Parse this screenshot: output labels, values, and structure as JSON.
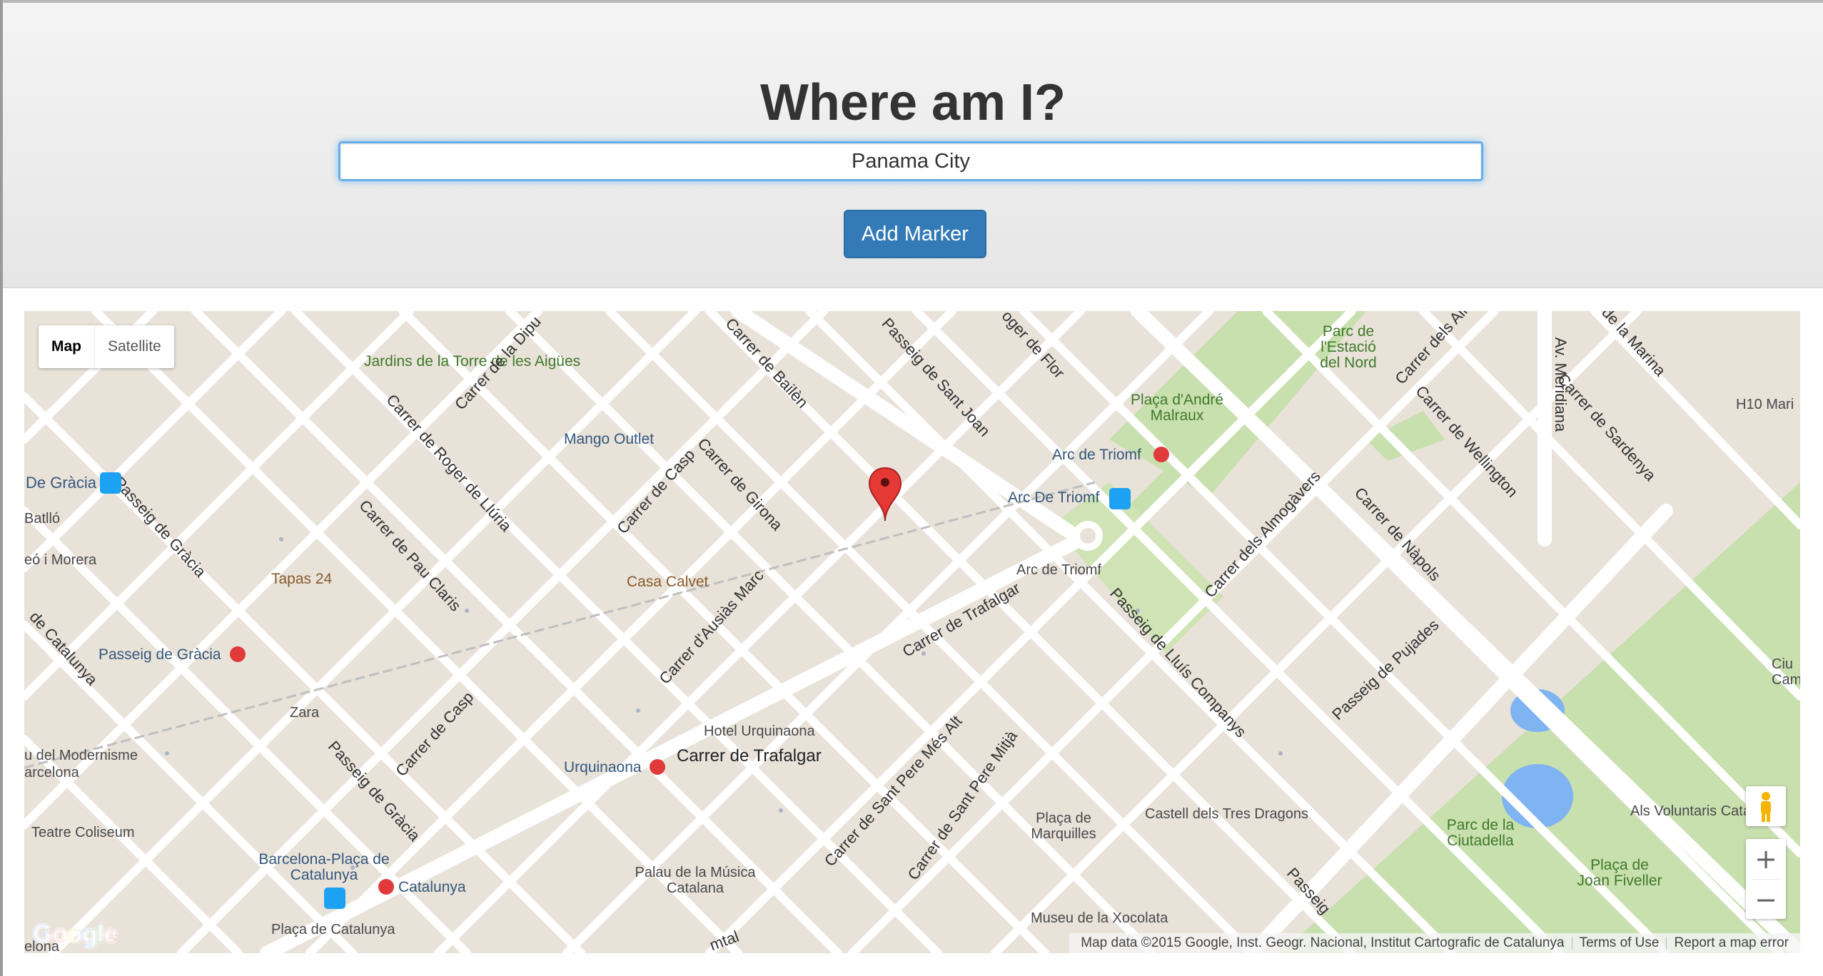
{
  "header": {
    "title": "Where am I?",
    "search_value": "Panama City",
    "add_marker_label": "Add Marker"
  },
  "map": {
    "type_control": {
      "map_label": "Map",
      "satellite_label": "Satellite"
    },
    "zoom_in": "+",
    "zoom_out": "−",
    "logo": "Google",
    "copyright": "Map data ©2015 Google, Inst. Geogr. Nacional, Institut Cartografic de Catalunya",
    "terms_link": "Terms of Use",
    "report_link": "Report a map error",
    "labels": {
      "jardins": "Jardins de la Torre de les Aigües",
      "parc_estacio": "Parc de l'Estació del Nord",
      "placa_malraux": "Plaça d'André Malraux",
      "h10": "H10 Mari",
      "mango": "Mango Outlet",
      "de_gracia": "De Gràcia",
      "batllo": "Batlló",
      "morera": "eó i Morera",
      "tapas": "Tapas 24",
      "casa_calvet": "Casa Calvet",
      "passeig_gracia_metro": "Passeig de Gràcia",
      "zara": "Zara",
      "hotel_urquinaona": "Hotel Urquinaona",
      "carrer_trafalgar_big": "Carrer de Trafalgar",
      "urquinaona": "Urquinaona",
      "modernisme": "u del Modernisme",
      "barcelona": "arcelona",
      "teatre": "Teatre Coliseum",
      "barcelona_placa": "Barcelona-Plaça de Catalunya",
      "catalunya": "Catalunya",
      "placa_catalunya": "Plaça de Catalunya",
      "elona": "elona",
      "palau": "Palau de la Música Catalana",
      "placa_marquilles": "Plaça de Marquilles",
      "castell": "Castell dels Tres Dragons",
      "xocolata": "Museu de la Xocolata",
      "arc_triomf_metro": "Arc de Triomf",
      "arc_triomf_bus": "Arc De Triomf",
      "arc_triomf_monument": "Arc de Triomf",
      "parc_ciutadella": "Parc de la Ciutadella",
      "placa_fiveller": "Plaça de Joan Fiveller",
      "voluntaris": "Als Voluntaris Catalan",
      "ciu": "Ciu Cam"
    },
    "streets": {
      "pau_claris": "Carrer de Pau Claris",
      "roger_lluria": "Carrer de Roger de Llúria",
      "passeig_gracia": "Passeig de Gràcia",
      "passeig_gracia_low": "Passeig de Gràcia",
      "carrer_casp": "Carrer de Casp",
      "carrer_casp_low": "Carrer de Casp",
      "carrer_girona": "Carrer de Girona",
      "carrer_bailen": "Carrer de Bailèn",
      "sant_joan": "Passeig de Sant Joan",
      "roger_flor": "oger de Flor",
      "diputacio": "Carrer de la Dipu",
      "ausias_marc": "Carrer d'Ausiàs Marc",
      "trafalgar": "Carrer de Trafalgar",
      "sant_pere_mes_alt": "Carrer de Sant Pere Més Alt",
      "sant_pere_mitja": "Carrer de Sant Pere Mitjà",
      "lluis_companys": "Passeig de Lluís Companys",
      "almogavers": "Carrer dels Almogàvers",
      "napols": "Carrer de Nàpols",
      "wellington": "Carrer de Wellington",
      "pujades": "Passeig de Pujades",
      "meridiana": "Av. Meridiana",
      "sardenya": "Carrer de Sardenya",
      "la_marina": "de la Marina",
      "carrer_dels_alm": "Carrer dels Alm",
      "de_catalunya": "de Catalunya",
      "passeig_bottom": "Passeig",
      "mtal": "mtal"
    }
  }
}
